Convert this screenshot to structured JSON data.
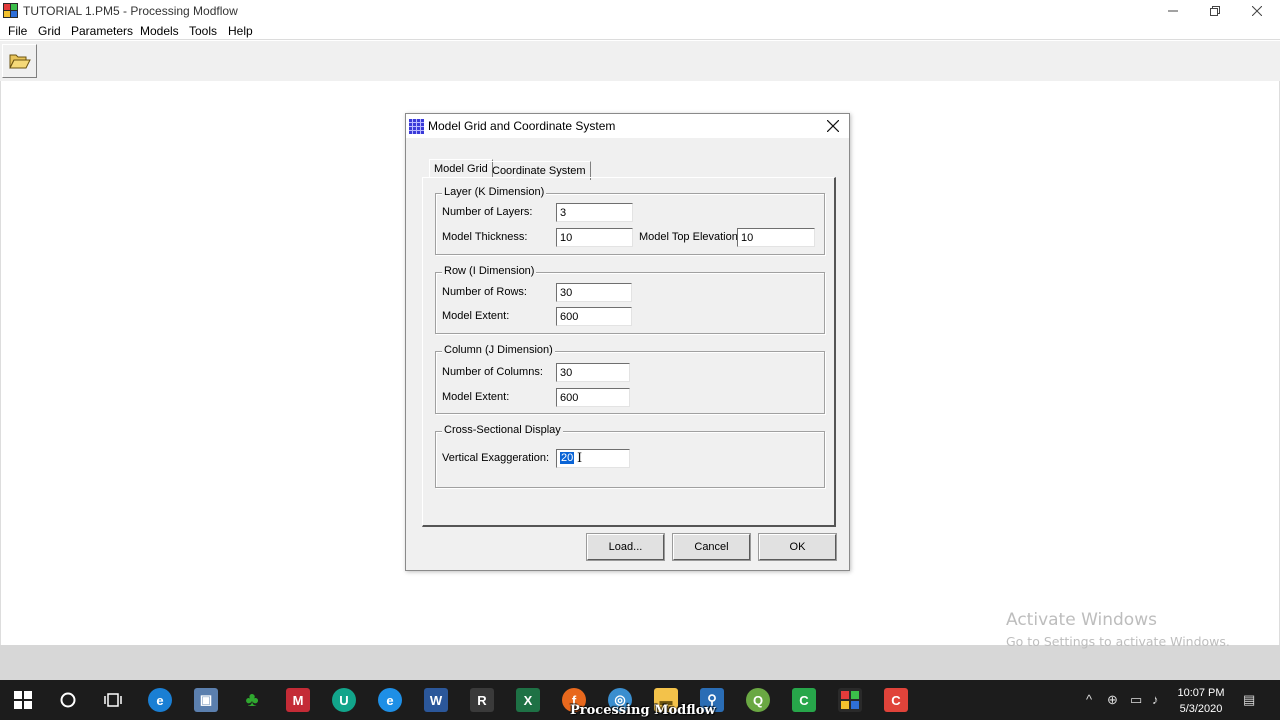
{
  "app": {
    "title": "TUTORIAL 1.PM5 - Processing Modflow",
    "menu": [
      "File",
      "Grid",
      "Parameters",
      "Models",
      "Tools",
      "Help"
    ]
  },
  "dialog": {
    "title": "Model Grid and Coordinate System",
    "tabs": [
      "Model Grid",
      "Coordinate System"
    ],
    "layer": {
      "legend": "Layer (K Dimension)",
      "num_layers_label": "Number of Layers:",
      "num_layers": "3",
      "thickness_label": "Model Thickness:",
      "thickness": "10",
      "top_elev_label": "Model Top Elevation:",
      "top_elev": "10"
    },
    "row": {
      "legend": "Row (I Dimension)",
      "num_rows_label": "Number of Rows:",
      "num_rows": "30",
      "extent_label": "Model Extent:",
      "extent": "600"
    },
    "column": {
      "legend": "Column (J Dimension)",
      "num_cols_label": "Number of Columns:",
      "num_cols": "30",
      "extent_label": "Model Extent:",
      "extent": "600"
    },
    "cross": {
      "legend": "Cross-Sectional Display",
      "vexag_label": "Vertical Exaggeration:",
      "vexag": "20"
    },
    "buttons": {
      "load": "Load...",
      "cancel": "Cancel",
      "ok": "OK"
    }
  },
  "watermark": {
    "line1": "Activate Windows",
    "line2": "Go to Settings to activate Windows."
  },
  "taskbar": {
    "caption": "Processing Modflow",
    "time": "10:07 PM",
    "date": "5/3/2020"
  },
  "colors": {
    "selection": "#0a64d6",
    "taskbar": "#1c1c1c",
    "dialog_bg": "#f0f0f0"
  }
}
